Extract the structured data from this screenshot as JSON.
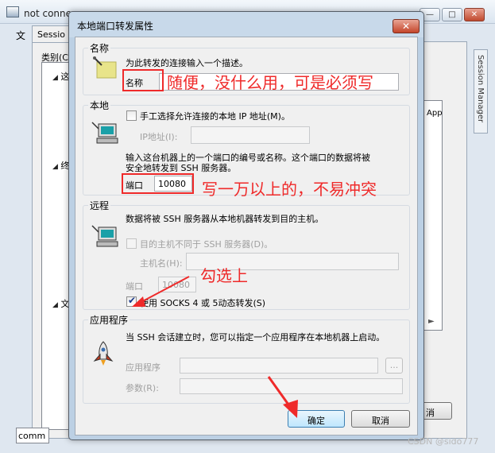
{
  "background_window": {
    "title": "not conne",
    "menu_label": "文",
    "session_tab": "Sessio",
    "category_label": "类别(C",
    "tree_arrow": "◢",
    "tree_items": [
      "这",
      "终",
      "文"
    ],
    "right_list_text": "App",
    "cancel_fragment": "消",
    "comm_field": "comm",
    "session_manager": "Session Manager"
  },
  "dialog": {
    "title": "本地端口转发属性",
    "close_glyph": "✕",
    "name_group": {
      "title": "名称",
      "description": "为此转发的连接输入一个描述。",
      "field_label": "名称",
      "field_value": ""
    },
    "local_group": {
      "title": "本地",
      "manual_ip_checkbox": "手工选择允许连接的本地 IP 地址(M)。",
      "ip_label": "IP地址(I):",
      "port_desc_line1": "输入这台机器上的一个端口的编号或名称。这个端口的数据将被",
      "port_desc_line2": "安全地转发到 SSH 服务器。",
      "port_label": "端口",
      "port_value": "10080"
    },
    "remote_group": {
      "title": "远程",
      "description": "数据将被 SSH 服务器从本地机器转发到目的主机。",
      "dest_checkbox": "目的主机不同于 SSH 服务器(D)。",
      "host_label": "主机名(H):",
      "port_label": "端口",
      "port_value": "10080",
      "socks_checkbox": "使用 SOCKS 4 或 5动态转发(S)",
      "socks_checked": true
    },
    "app_group": {
      "title": "应用程序",
      "description": "当 SSH 会话建立时，您可以指定一个应用程序在本地机器上启动。",
      "app_label": "应用程序",
      "params_label": "参数(R):",
      "browse_button": "..."
    },
    "ok_button": "确定",
    "cancel_button": "取消"
  },
  "annotations": {
    "name_note": "随便，没什么用，可是必须写",
    "port_note": "写一万以上的，不易冲突",
    "socks_note": "勾选上"
  },
  "watermark": "CSDN @sido777",
  "colors": {
    "annotation_red": "#ef2a2a",
    "dialog_frame": "#bcd0e4",
    "panel": "#f0f0f0"
  },
  "icons": [
    "app-window-icon",
    "pen-tag-icon",
    "computer-icon",
    "rocket-icon",
    "checkmark-icon",
    "close-icon"
  ]
}
